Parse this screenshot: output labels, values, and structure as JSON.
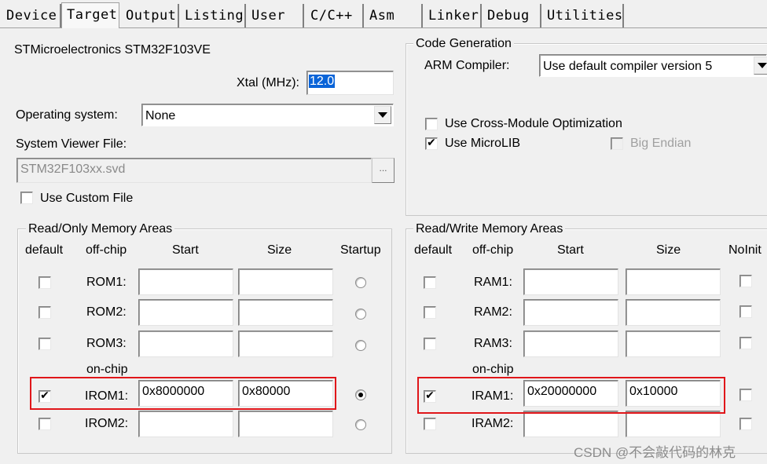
{
  "tabs": [
    {
      "label": "Device"
    },
    {
      "label": "Target"
    },
    {
      "label": "Output"
    },
    {
      "label": "Listing"
    },
    {
      "label": "User"
    },
    {
      "label": "C/C++"
    },
    {
      "label": "Asm"
    },
    {
      "label": "Linker"
    },
    {
      "label": "Debug"
    },
    {
      "label": "Utilities"
    }
  ],
  "active_tab": "Target",
  "device": {
    "name": "STMicroelectronics STM32F103VE"
  },
  "xtal": {
    "label": "Xtal (MHz):",
    "value": "12.0"
  },
  "os": {
    "label": "Operating system:",
    "value": "None"
  },
  "svf": {
    "label": "System Viewer File:",
    "value": "STM32F103xx.svd",
    "browse": "..."
  },
  "custom_file": {
    "label": "Use Custom File",
    "checked": false
  },
  "code_gen": {
    "legend": "Code Generation",
    "compiler_label": "ARM Compiler:",
    "compiler_value": "Use default compiler version 5",
    "cross_module": {
      "label": "Use Cross-Module Optimization",
      "checked": false
    },
    "microlib": {
      "label": "Use MicroLIB",
      "checked": true
    },
    "big_endian": {
      "label": "Big Endian",
      "checked": false,
      "enabled": false
    }
  },
  "ro_mem": {
    "legend": "Read/Only Memory Areas",
    "headers": {
      "default": "default",
      "offchip": "off-chip",
      "start": "Start",
      "size": "Size",
      "startup": "Startup"
    },
    "onchip_label": "on-chip",
    "rows": [
      {
        "name": "ROM1:",
        "checked": false,
        "start": "",
        "size": "",
        "startup": false
      },
      {
        "name": "ROM2:",
        "checked": false,
        "start": "",
        "size": "",
        "startup": false
      },
      {
        "name": "ROM3:",
        "checked": false,
        "start": "",
        "size": "",
        "startup": false
      },
      {
        "name": "IROM1:",
        "checked": true,
        "start": "0x8000000",
        "size": "0x80000",
        "startup": true
      },
      {
        "name": "IROM2:",
        "checked": false,
        "start": "",
        "size": "",
        "startup": false
      }
    ]
  },
  "rw_mem": {
    "legend": "Read/Write Memory Areas",
    "headers": {
      "default": "default",
      "offchip": "off-chip",
      "start": "Start",
      "size": "Size",
      "noinit": "NoInit"
    },
    "onchip_label": "on-chip",
    "rows": [
      {
        "name": "RAM1:",
        "checked": false,
        "start": "",
        "size": "",
        "noinit": false
      },
      {
        "name": "RAM2:",
        "checked": false,
        "start": "",
        "size": "",
        "noinit": false
      },
      {
        "name": "RAM3:",
        "checked": false,
        "start": "",
        "size": "",
        "noinit": false
      },
      {
        "name": "IRAM1:",
        "checked": true,
        "start": "0x20000000",
        "size": "0x10000",
        "noinit": false
      },
      {
        "name": "IRAM2:",
        "checked": false,
        "start": "",
        "size": "",
        "noinit": false
      }
    ]
  },
  "colors": {
    "highlight": "#e0161a",
    "selection": "#0a64d8"
  },
  "watermark": "CSDN @不会敲代码的林克"
}
